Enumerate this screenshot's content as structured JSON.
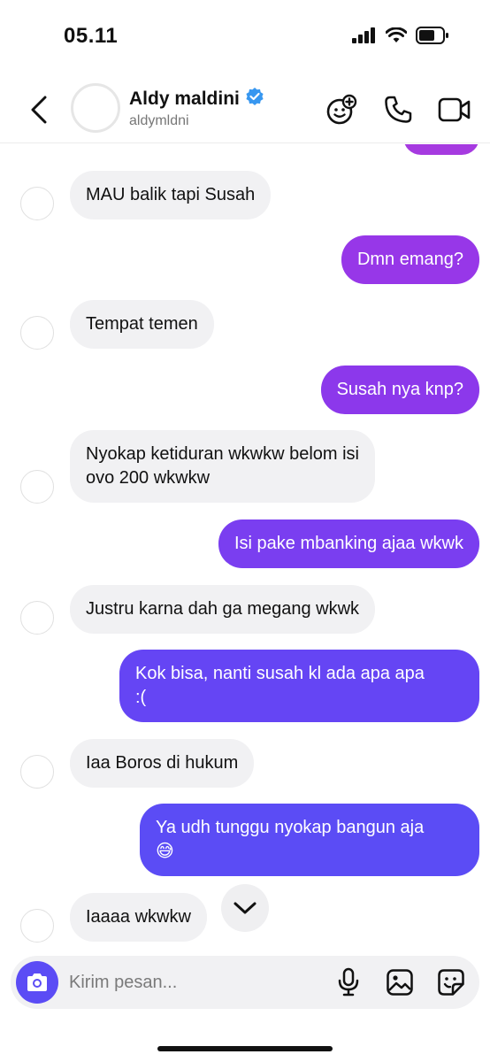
{
  "status_bar": {
    "time": "05.11"
  },
  "header": {
    "contact_name": "Aldy maldini",
    "username": "aldymldni",
    "verified": true,
    "icons": [
      "back-icon",
      "effects-icon",
      "phone-icon",
      "video-icon"
    ]
  },
  "colors": {
    "recv_bubble": "#f1f1f3",
    "sent_top": "#9333ea",
    "sent_mid": "#7c3aed",
    "sent_bottom": "#5b4cf5",
    "verified": "#3797f0"
  },
  "messages": [
    {
      "dir": "sent",
      "text": ""
    },
    {
      "dir": "recv",
      "text": "MAU balik tapi Susah"
    },
    {
      "dir": "sent",
      "text": "Dmn emang?"
    },
    {
      "dir": "recv",
      "text": "Tempat temen"
    },
    {
      "dir": "sent",
      "text": "Susah nya knp?"
    },
    {
      "dir": "recv",
      "line1": "Nyokap ketiduran wkwkw belom isi",
      "line2": "ovo 200 wkwkw"
    },
    {
      "dir": "sent",
      "text": "Isi pake mbanking ajaa wkwk"
    },
    {
      "dir": "recv",
      "text": "Justru karna dah ga megang wkwk"
    },
    {
      "dir": "sent",
      "line1": "Kok bisa, nanti susah kl ada apa apa",
      "line2": ":("
    },
    {
      "dir": "recv",
      "text": "Iaa Boros di hukum"
    },
    {
      "dir": "sent",
      "line1": "Ya udh tunggu nyokap bangun aja",
      "line2": "😅"
    },
    {
      "dir": "recv",
      "text": "Iaaaa wkwkw"
    }
  ],
  "composer": {
    "placeholder": "Kirim pesan..."
  }
}
